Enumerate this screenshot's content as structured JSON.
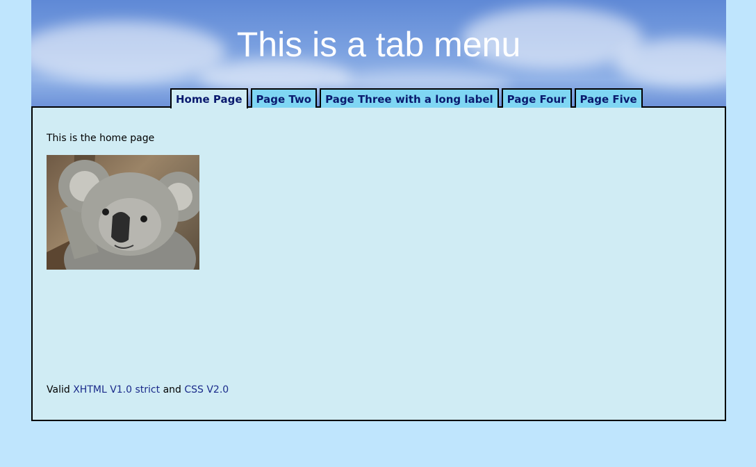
{
  "header": {
    "title": "This is a tab menu"
  },
  "tabs": [
    {
      "label": "Home Page",
      "active": true
    },
    {
      "label": "Page Two",
      "active": false
    },
    {
      "label": "Page Three with a long label",
      "active": false
    },
    {
      "label": "Page Four",
      "active": false
    },
    {
      "label": "Page Five",
      "active": false
    }
  ],
  "content": {
    "intro": "This is the home page",
    "image_subject": "koala-photo"
  },
  "footer": {
    "prefix": "Valid",
    "link1": "XHTML V1.0 strict",
    "middle": "and",
    "link2": "CSS V2.0"
  },
  "colors": {
    "page_background": "#bfe5fd",
    "content_background": "#d0ecf4",
    "tab_background": "#7fd6f3",
    "tab_text": "#0a1a6e",
    "link": "#1a2a8a",
    "title_text": "#ffffff"
  }
}
